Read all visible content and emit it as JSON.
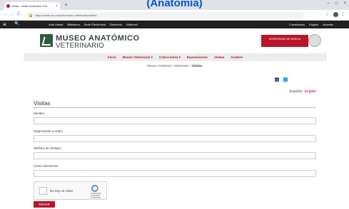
{
  "overlay": {
    "title": "(Anatomía)"
  },
  "browser": {
    "tab_title": "Visitas - Museo Anatómico Vete",
    "tab_close": "×",
    "new_tab": "+",
    "url": "https://www.um.es/web/museo-veterinario/visitas",
    "window_controls": [
      "–",
      "□",
      "×"
    ],
    "nav_buttons": [
      "←",
      "→",
      "C"
    ]
  },
  "topbar": {
    "links": [
      "Aula Virtual",
      "Biblioteca",
      "Sede Electrónica",
      "Directorio",
      "Webmail"
    ],
    "right_links": [
      "Consultanos",
      "English",
      "Acceder"
    ]
  },
  "header": {
    "brand_line1": "MUSEO ANATÓMICO",
    "brand_line2": "VETERINARIO",
    "university": "UNIVERSIDAD DE MURCIA"
  },
  "nav": {
    "items": [
      "Inicio",
      "Museo Veterinario ▾",
      "Colecciones ▾",
      "Exposiciones",
      "Visitas",
      "Anatree"
    ]
  },
  "breadcrumb": {
    "parent": "Museo Anatómico Veterinario",
    "current": "Visitas"
  },
  "social": {
    "facebook": "f",
    "twitter": "t"
  },
  "lang": {
    "es": "Español",
    "en": "English"
  },
  "form": {
    "title": "Visitas",
    "fields": [
      {
        "label": "Nombre",
        "value": ""
      },
      {
        "label": "Organización o centro",
        "value": ""
      },
      {
        "label": "Teléfono de contacto",
        "value": ""
      },
      {
        "label": "Correo electrónico",
        "value": ""
      }
    ],
    "captcha_label": "No soy un robot",
    "captcha_brand": "reCAPTCHA",
    "captcha_terms": "Privacidad - Condiciones",
    "submit_label": "ENVIAR"
  },
  "colors": {
    "brand_red": "#b7162b",
    "logo_green": "#2e5d3b",
    "topbar": "#1f1f1f"
  }
}
